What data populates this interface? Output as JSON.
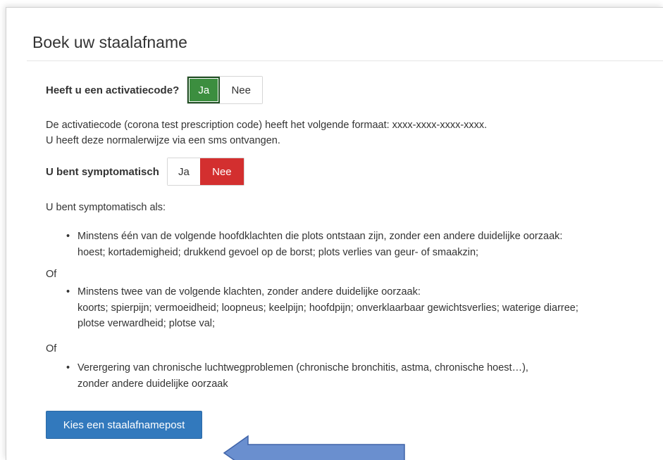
{
  "page": {
    "title": "Boek uw staalafname"
  },
  "activation": {
    "question": "Heeft u een activatiecode?",
    "options": [
      "Ja",
      "Nee"
    ],
    "selected": "Ja",
    "info_line1": "De activatiecode (corona test prescription code) heeft het volgende formaat: xxxx-xxxx-xxxx-xxxx.",
    "info_line2": "U heeft deze normalerwijze via een sms ontvangen."
  },
  "symptomatic": {
    "question": "U bent symptomatisch",
    "options": [
      "Ja",
      "Nee"
    ],
    "selected": "Nee",
    "intro": "U bent symptomatisch als:",
    "bullets": [
      {
        "line1": "Minstens één van de volgende hoofdklachten die plots ontstaan zijn, zonder een andere duidelijke oorzaak:",
        "line2": "hoest; kortademigheid; drukkend gevoel op de borst; plots verlies van geur- of smaakzin;"
      },
      {
        "line1": "Minstens twee van de volgende klachten, zonder andere duidelijke oorzaak:",
        "line2": "koorts; spierpijn; vermoeidheid; loopneus; keelpijn; hoofdpijn; onverklaarbaar gewichtsverlies; waterige diarree;",
        "line3": "plotse verwardheid; plotse val;"
      },
      {
        "line1": "Verergering van chronische luchtwegproblemen (chronische bronchitis, astma, chronische hoest…),",
        "line2": "zonder andere duidelijke oorzaak"
      }
    ],
    "separator": "Of"
  },
  "actions": {
    "primary_label": "Kies een staalafnamepost"
  },
  "colors": {
    "yes_selected": "#3c8e3f",
    "no_selected": "#d32f2f",
    "primary": "#3279bd",
    "arrow": "#6a8fcf"
  }
}
